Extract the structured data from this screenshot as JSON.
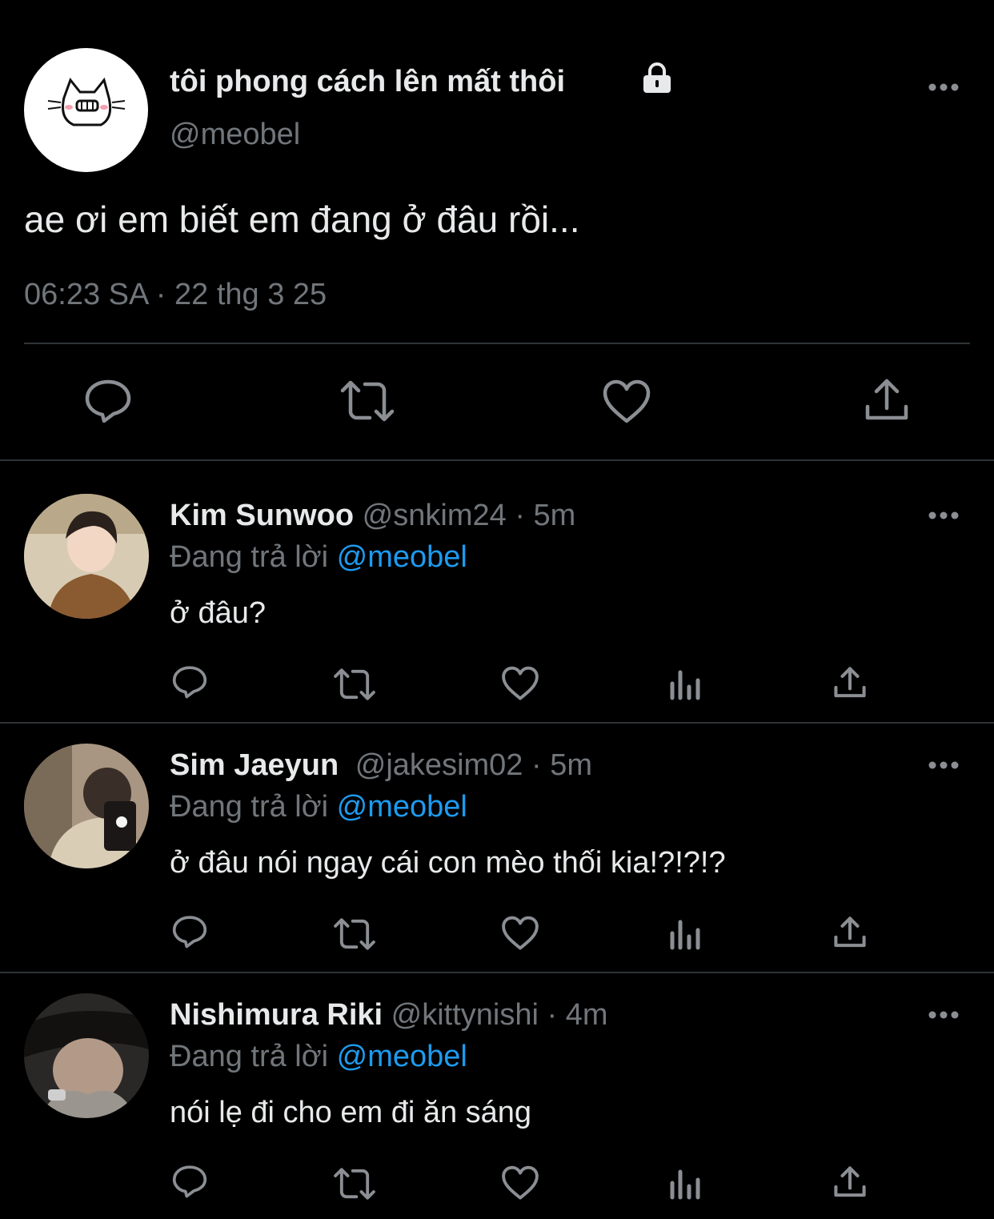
{
  "main_tweet": {
    "display_name": "tôi phong cách lên mất thôi",
    "handle": "@meobel",
    "text": "ae ơi em biết em đang ở đâu rồi...",
    "timestamp": "06:23 SA · 22 thg 3 25",
    "avatar_icon": "cat-face-icon",
    "actions": [
      "reply-icon",
      "retweet-icon",
      "like-icon",
      "share-icon"
    ]
  },
  "replies": [
    {
      "display_name": "Kim Sunwoo",
      "handle": "@snkim24",
      "time": "· 5m",
      "replying_label": "Đang trả lời",
      "replying_to": "@meobel",
      "text": "ở đâu?"
    },
    {
      "display_name": "Sim Jaeyun",
      "handle": "@jakesim02",
      "time": "· 5m",
      "replying_label": "Đang trả lời",
      "replying_to": "@meobel",
      "text": "ở đâu nói ngay cái con mèo thối kia!?!?!?"
    },
    {
      "display_name": "Nishimura Riki",
      "handle": "@kittynishi",
      "time": "· 4m",
      "replying_label": "Đang trả lời",
      "replying_to": "@meobel",
      "text": "nói lẹ đi cho em đi ăn sáng"
    }
  ],
  "colors": {
    "background": "#000000",
    "text": "#e7e9ea",
    "muted": "#71767b",
    "link": "#1d9bf0",
    "divider": "#2f3336"
  }
}
